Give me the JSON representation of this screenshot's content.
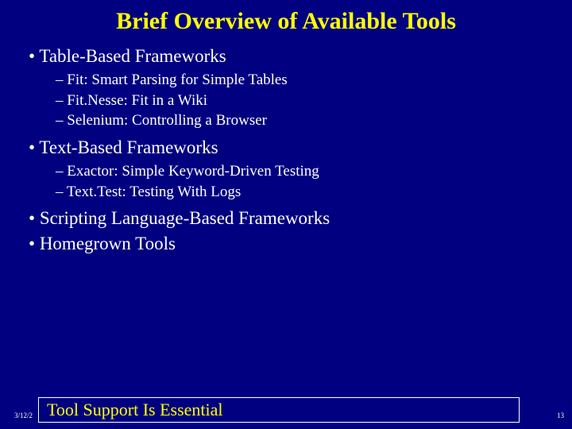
{
  "title": "Brief Overview of Available Tools",
  "bullets": [
    {
      "label": "Table-Based Frameworks",
      "sub": [
        "Fit: Smart Parsing for Simple Tables",
        "Fit.Nesse:  Fit in a Wiki",
        "Selenium:  Controlling a Browser"
      ]
    },
    {
      "label": "Text-Based Frameworks",
      "sub": [
        "Exactor:  Simple Keyword-Driven Testing",
        "Text.Test:  Testing With Logs"
      ]
    },
    {
      "label": "Scripting Language-Based Frameworks",
      "sub": []
    },
    {
      "label": "Homegrown Tools",
      "sub": []
    }
  ],
  "footer": {
    "caption": "Tool Support Is Essential",
    "date": "3/12/2",
    "page": "13"
  }
}
